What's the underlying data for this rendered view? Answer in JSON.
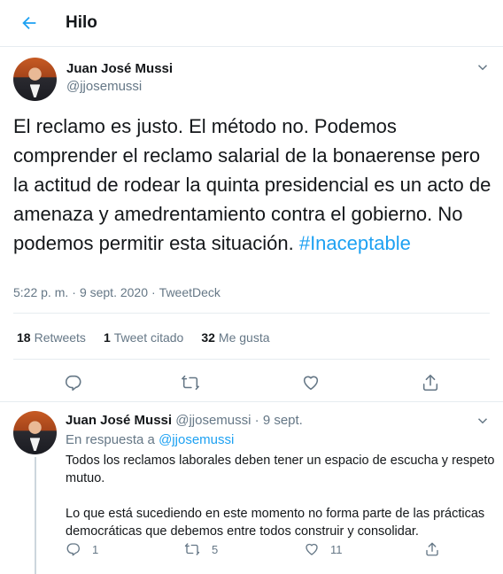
{
  "header": {
    "title": "Hilo",
    "back_icon": "arrow-left-icon",
    "accent": "#1da1f2"
  },
  "main_tweet": {
    "author_name": "Juan José Mussi",
    "author_handle": "@jjosemussi",
    "text": "El reclamo es justo. El método no. Podemos comprender el reclamo salarial de la bonaerense pero la actitud de rodear la quinta presidencial es un acto de amenaza y amedrentamiento contra el gobierno. No podemos permitir esta situación.",
    "hashtag": "#Inaceptable",
    "time": "5:22 p. m.",
    "separator": "·",
    "date": "9 sept. 2020",
    "source": "TweetDeck",
    "stats": {
      "retweets_count": "18",
      "retweets_label": "Retweets",
      "quotes_count": "1",
      "quotes_label": "Tweet citado",
      "likes_count": "32",
      "likes_label": "Me gusta"
    }
  },
  "reply": {
    "author_name": "Juan José Mussi",
    "author_handle": "@jjosemussi",
    "separator": "·",
    "date": "9 sept.",
    "in_reply_prefix": "En respuesta a",
    "in_reply_handle": "@jjosemussi",
    "paragraph1": "Todos los reclamos laborales deben tener un espacio de escucha y respeto mutuo.",
    "paragraph2": "Lo que está sucediendo en este momento no forma parte de las prácticas democráticas que debemos entre todos construir y consolidar.",
    "replies_count": "1",
    "retweets_count": "5",
    "likes_count": "11"
  }
}
